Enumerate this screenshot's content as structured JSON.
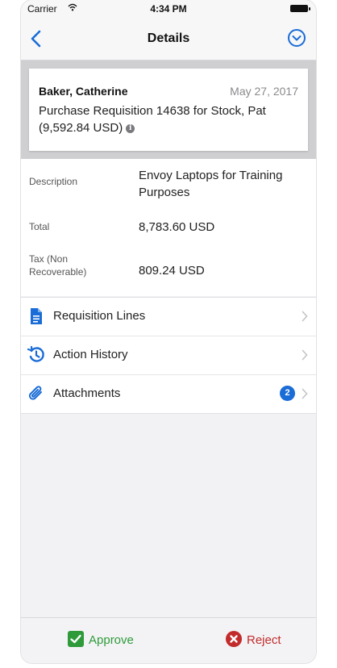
{
  "status_bar": {
    "carrier": "Carrier",
    "time": "4:34 PM"
  },
  "nav": {
    "title": "Details"
  },
  "summary": {
    "requester": "Baker, Catherine",
    "date": "May 27, 2017",
    "title": "Purchase Requisition 14638 for Stock, Pat (9,592.84 USD)"
  },
  "details": {
    "description_label": "Description",
    "description_value": "Envoy Laptops for Training Purposes",
    "total_label": "Total",
    "total_value": "8,783.60 USD",
    "tax_label": "Tax (Non Recoverable)",
    "tax_value": "809.24 USD"
  },
  "sections": {
    "requisition_lines": "Requisition Lines",
    "action_history": "Action History",
    "attachments": "Attachments",
    "attachments_count": "2"
  },
  "toolbar": {
    "approve": "Approve",
    "reject": "Reject"
  },
  "colors": {
    "accent": "#1a6cd6",
    "approve": "#2e9a3a",
    "reject": "#c22b2b"
  },
  "icons": {
    "back": "chevron-left-icon",
    "menu": "chevron-down-circle-icon",
    "requisition_lines": "document-icon",
    "action_history": "history-icon",
    "attachments": "paperclip-icon"
  }
}
